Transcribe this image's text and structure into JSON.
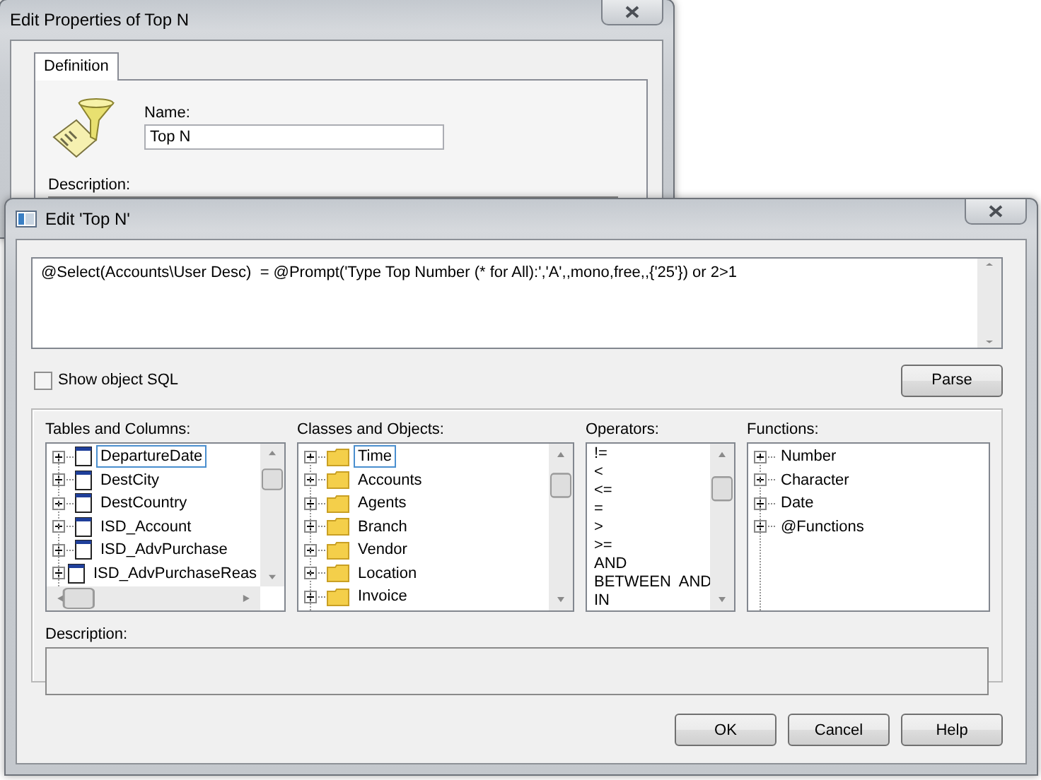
{
  "back_window": {
    "title": "Edit Properties of Top N",
    "tabs": [
      {
        "label": "Definition",
        "selected": true
      }
    ],
    "name_label": "Name:",
    "name_value": "Top N",
    "description_label": "Description:"
  },
  "edit_window": {
    "title": "Edit 'Top N'",
    "formula": "@Select(Accounts\\User Desc)  = @Prompt('Type Top Number (* for All):','A',,mono,free,,{'25'}) or 2>1",
    "show_sql": {
      "label": "Show object SQL",
      "checked": false
    },
    "parse_button": "Parse",
    "tables": {
      "label": "Tables and Columns:",
      "items": [
        {
          "label": "DepartureDate",
          "expanded": false,
          "selected": true
        },
        {
          "label": "DestCity",
          "expanded": false,
          "selected": false
        },
        {
          "label": "DestCountry",
          "expanded": false,
          "selected": false
        },
        {
          "label": "ISD_Account",
          "expanded": false,
          "selected": false
        },
        {
          "label": "ISD_AdvPurchase",
          "expanded": false,
          "selected": false
        },
        {
          "label": "ISD_AdvPurchaseReas",
          "expanded": false,
          "selected": false
        }
      ]
    },
    "classes": {
      "label": "Classes and Objects:",
      "items": [
        {
          "label": "Time",
          "expanded": false,
          "selected": true
        },
        {
          "label": "Accounts",
          "expanded": false,
          "selected": false
        },
        {
          "label": "Agents",
          "expanded": false,
          "selected": false
        },
        {
          "label": "Branch",
          "expanded": false,
          "selected": false
        },
        {
          "label": "Vendor",
          "expanded": false,
          "selected": false
        },
        {
          "label": "Location",
          "expanded": false,
          "selected": false
        },
        {
          "label": "Invoice",
          "expanded": false,
          "selected": false
        }
      ]
    },
    "operators": {
      "label": "Operators:",
      "items": [
        "!=",
        "<",
        "<=",
        "=",
        ">",
        ">=",
        "AND",
        "BETWEEN  AND",
        "IN"
      ]
    },
    "functions": {
      "label": "Functions:",
      "items": [
        {
          "label": "Number",
          "expanded": false
        },
        {
          "label": "Character",
          "expanded": false
        },
        {
          "label": "Date",
          "expanded": false
        },
        {
          "label": "@Functions",
          "expanded": false
        }
      ]
    },
    "description_label": "Description:",
    "buttons": [
      "OK",
      "Cancel",
      "Help"
    ]
  }
}
